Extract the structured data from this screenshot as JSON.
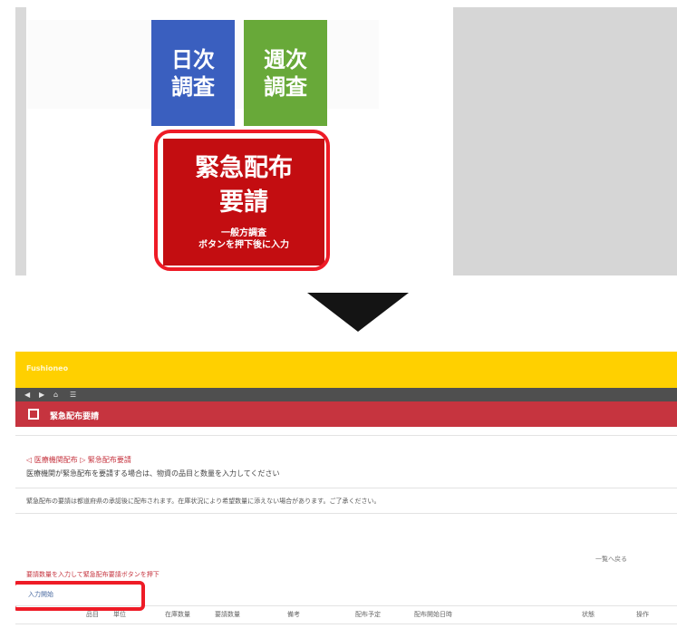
{
  "tiles": {
    "daily": {
      "line1": "日次",
      "line2": "調査"
    },
    "weekly": {
      "line1": "週次",
      "line2": "調査"
    },
    "emergency": {
      "line1": "緊急配布",
      "line2": "要請",
      "sub1": "一般方調査",
      "sub2": "ボタンを押下後に入力"
    }
  },
  "app": {
    "header_title": "Fushioneo",
    "nav_items": [
      "◀",
      "▶",
      "⌂",
      "☰"
    ],
    "section_title": "緊急配布要請",
    "breadcrumb": "◁ 医療機関配布 ▷ 緊急配布要請",
    "notice": "医療機関が緊急配布を要請する場合は、物資の品目と数量を入力してください",
    "description": "緊急配布の要請は都道府県の承認後に配布されます。在庫状況により希望数量に添えない場合があります。ご了承ください。",
    "form_link": "要請数量を入力して緊急配布要請ボタンを押下",
    "input_label": "入力開始",
    "columns": [
      "品目",
      "単位",
      "在庫数量",
      "要請数量",
      "備考",
      "配布予定",
      "配布開始日時",
      "状態",
      "操作"
    ],
    "right_label": "一覧へ戻る"
  },
  "colors": {
    "daily": "#3a5fbf",
    "weekly": "#68a939",
    "emergency": "#c30d11",
    "highlight": "#ee1b26",
    "header_yellow": "#ffd000",
    "header_red": "#c6343f"
  }
}
